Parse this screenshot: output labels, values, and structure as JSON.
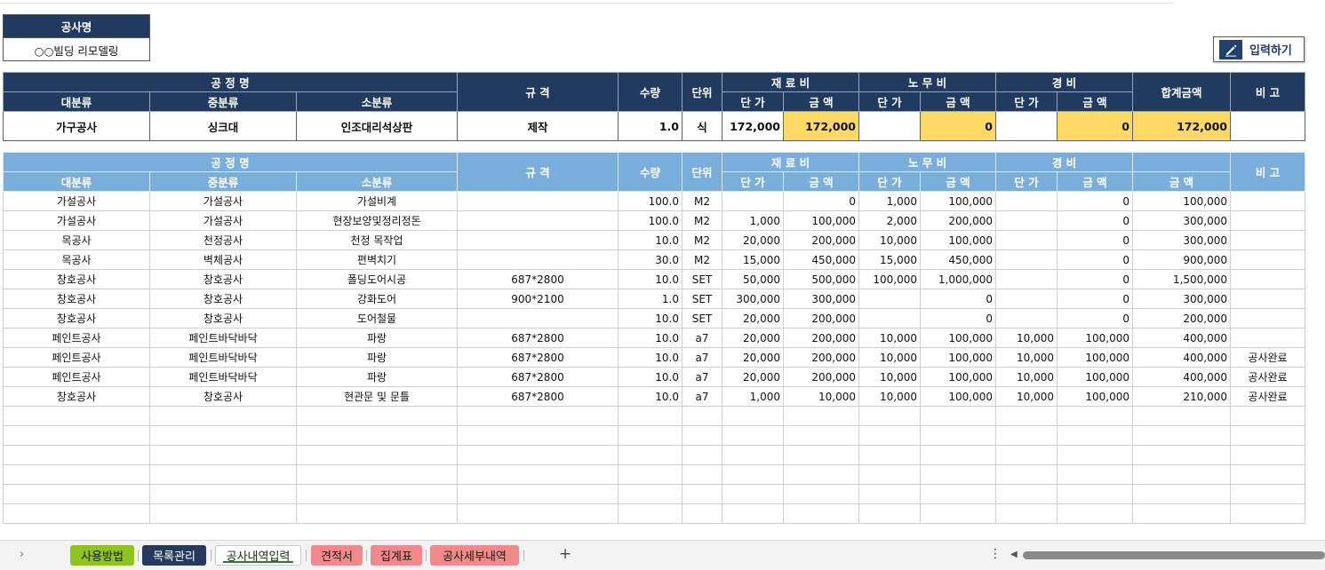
{
  "project": {
    "label": "공사명",
    "value": "○○빌딩 리모델링"
  },
  "input_button": {
    "label": "입력하기",
    "icon": "pencil-icon"
  },
  "headers": {
    "process": "공 정 명",
    "major": "대분류",
    "middle": "중분류",
    "minor": "소분류",
    "spec": "규 격",
    "qty": "수량",
    "unit": "단위",
    "material": "재 료 비",
    "labor": "노 무 비",
    "expense": "경 비",
    "unit_price": "단 가",
    "amount": "금 액",
    "total": "합계금액",
    "total_amount": "금 액",
    "note": "비 고"
  },
  "summary": {
    "major": "가구공사",
    "middle": "싱크대",
    "minor": "인조대리석상판",
    "spec": "제작",
    "qty": "1.0",
    "unit": "식",
    "mat_price": "172,000",
    "mat_amount": "172,000",
    "lab_price": "",
    "lab_amount": "0",
    "exp_price": "",
    "exp_amount": "0",
    "total": "172,000",
    "note": ""
  },
  "rows": [
    {
      "major": "가설공사",
      "middle": "가설공사",
      "minor": "가설비계",
      "spec": "",
      "qty": "100.0",
      "unit": "M2",
      "mp": "",
      "ma": "0",
      "lp": "1,000",
      "la": "100,000",
      "ep": "",
      "ea": "0",
      "total": "100,000",
      "note": ""
    },
    {
      "major": "가설공사",
      "middle": "가설공사",
      "minor": "현장보양및정리정돈",
      "spec": "",
      "qty": "100.0",
      "unit": "M2",
      "mp": "1,000",
      "ma": "100,000",
      "lp": "2,000",
      "la": "200,000",
      "ep": "",
      "ea": "0",
      "total": "300,000",
      "note": ""
    },
    {
      "major": "목공사",
      "middle": "천정공사",
      "minor": "천정 목작업",
      "spec": "",
      "qty": "10.0",
      "unit": "M2",
      "mp": "20,000",
      "ma": "200,000",
      "lp": "10,000",
      "la": "100,000",
      "ep": "",
      "ea": "0",
      "total": "300,000",
      "note": ""
    },
    {
      "major": "목공사",
      "middle": "벽체공사",
      "minor": "편벽치기",
      "spec": "",
      "qty": "30.0",
      "unit": "M2",
      "mp": "15,000",
      "ma": "450,000",
      "lp": "15,000",
      "la": "450,000",
      "ep": "",
      "ea": "0",
      "total": "900,000",
      "note": ""
    },
    {
      "major": "창호공사",
      "middle": "창호공사",
      "minor": "폴딩도어시공",
      "spec": "687*2800",
      "qty": "10.0",
      "unit": "SET",
      "mp": "50,000",
      "ma": "500,000",
      "lp": "100,000",
      "la": "1,000,000",
      "ep": "",
      "ea": "0",
      "total": "1,500,000",
      "note": ""
    },
    {
      "major": "창호공사",
      "middle": "창호공사",
      "minor": "강화도어",
      "spec": "900*2100",
      "qty": "1.0",
      "unit": "SET",
      "mp": "300,000",
      "ma": "300,000",
      "lp": "",
      "la": "0",
      "ep": "",
      "ea": "0",
      "total": "300,000",
      "note": ""
    },
    {
      "major": "창호공사",
      "middle": "창호공사",
      "minor": "도어철물",
      "spec": "",
      "qty": "10.0",
      "unit": "SET",
      "mp": "20,000",
      "ma": "200,000",
      "lp": "",
      "la": "0",
      "ep": "",
      "ea": "0",
      "total": "200,000",
      "note": ""
    },
    {
      "major": "페인트공사",
      "middle": "페인트바닥바닥",
      "minor": "파랑",
      "spec": "687*2800",
      "qty": "10.0",
      "unit": "a7",
      "mp": "20,000",
      "ma": "200,000",
      "lp": "10,000",
      "la": "100,000",
      "ep": "10,000",
      "ea": "100,000",
      "total": "400,000",
      "note": ""
    },
    {
      "major": "페인트공사",
      "middle": "페인트바닥바닥",
      "minor": "파랑",
      "spec": "687*2800",
      "qty": "10.0",
      "unit": "a7",
      "mp": "20,000",
      "ma": "200,000",
      "lp": "10,000",
      "la": "100,000",
      "ep": "10,000",
      "ea": "100,000",
      "total": "400,000",
      "note": "공사완료"
    },
    {
      "major": "페인트공사",
      "middle": "페인트바닥바닥",
      "minor": "파랑",
      "spec": "687*2800",
      "qty": "10.0",
      "unit": "a7",
      "mp": "20,000",
      "ma": "200,000",
      "lp": "10,000",
      "la": "100,000",
      "ep": "10,000",
      "ea": "100,000",
      "total": "400,000",
      "note": "공사완료"
    },
    {
      "major": "창호공사",
      "middle": "창호공사",
      "minor": "현관문 및 문틀",
      "spec": "687*2800",
      "qty": "10.0",
      "unit": "a7",
      "mp": "1,000",
      "ma": "10,000",
      "lp": "10,000",
      "la": "100,000",
      "ep": "10,000",
      "ea": "100,000",
      "total": "210,000",
      "note": "공사완료"
    }
  ],
  "sheet_tabs": [
    {
      "label": "사용방법",
      "style": "green"
    },
    {
      "label": "목록관리",
      "style": "navy"
    },
    {
      "label": "공사내역입력",
      "style": "active"
    },
    {
      "label": "견적서",
      "style": "pink"
    },
    {
      "label": "집계표",
      "style": "pink"
    },
    {
      "label": "공사세부내역",
      "style": "pink"
    }
  ],
  "tabbar_icons": {
    "nav": "chevron-right-icon",
    "add": "plus-icon",
    "more": "more-dots-icon"
  }
}
